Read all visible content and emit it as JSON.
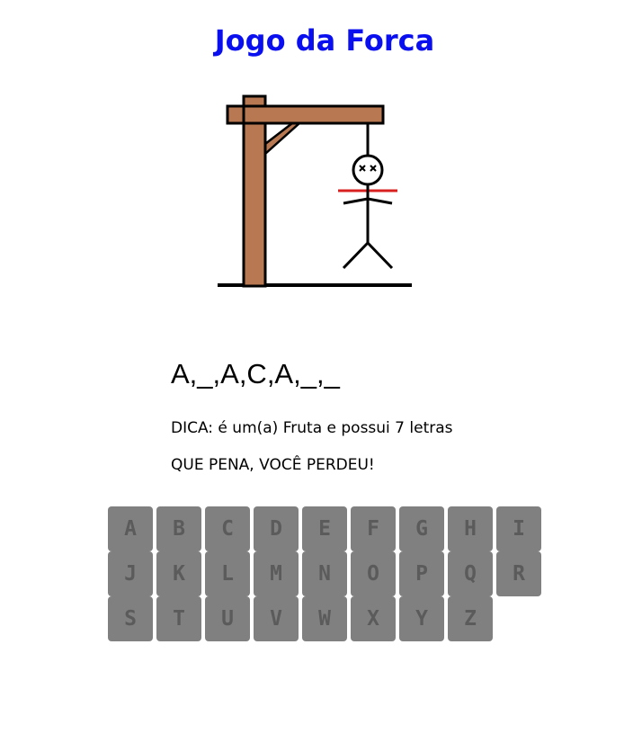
{
  "game": {
    "title": "Jogo da Forca",
    "word_display": "A,_,A,C,A,_,_",
    "hint": "DICA: é um(a) Fruta e possui 7 letras",
    "result": "QUE PENA, VOCÊ PERDEU!"
  },
  "keyboard": {
    "rows": [
      [
        "A",
        "B",
        "C",
        "D",
        "E",
        "F",
        "G",
        "H",
        "I"
      ],
      [
        "J",
        "K",
        "L",
        "M",
        "N",
        "O",
        "P",
        "Q",
        "R"
      ],
      [
        "S",
        "T",
        "U",
        "V",
        "W",
        "X",
        "Y",
        "Z"
      ]
    ],
    "all_disabled": true
  },
  "colors": {
    "title": "#0a0ff0",
    "gallows_wood": "#b87852",
    "rope": "#000000",
    "neck_line": "#d92020",
    "key_background": "#808080",
    "key_text": "#5b5b5b"
  },
  "figure": {
    "state": "dead",
    "eyes": "x x"
  }
}
